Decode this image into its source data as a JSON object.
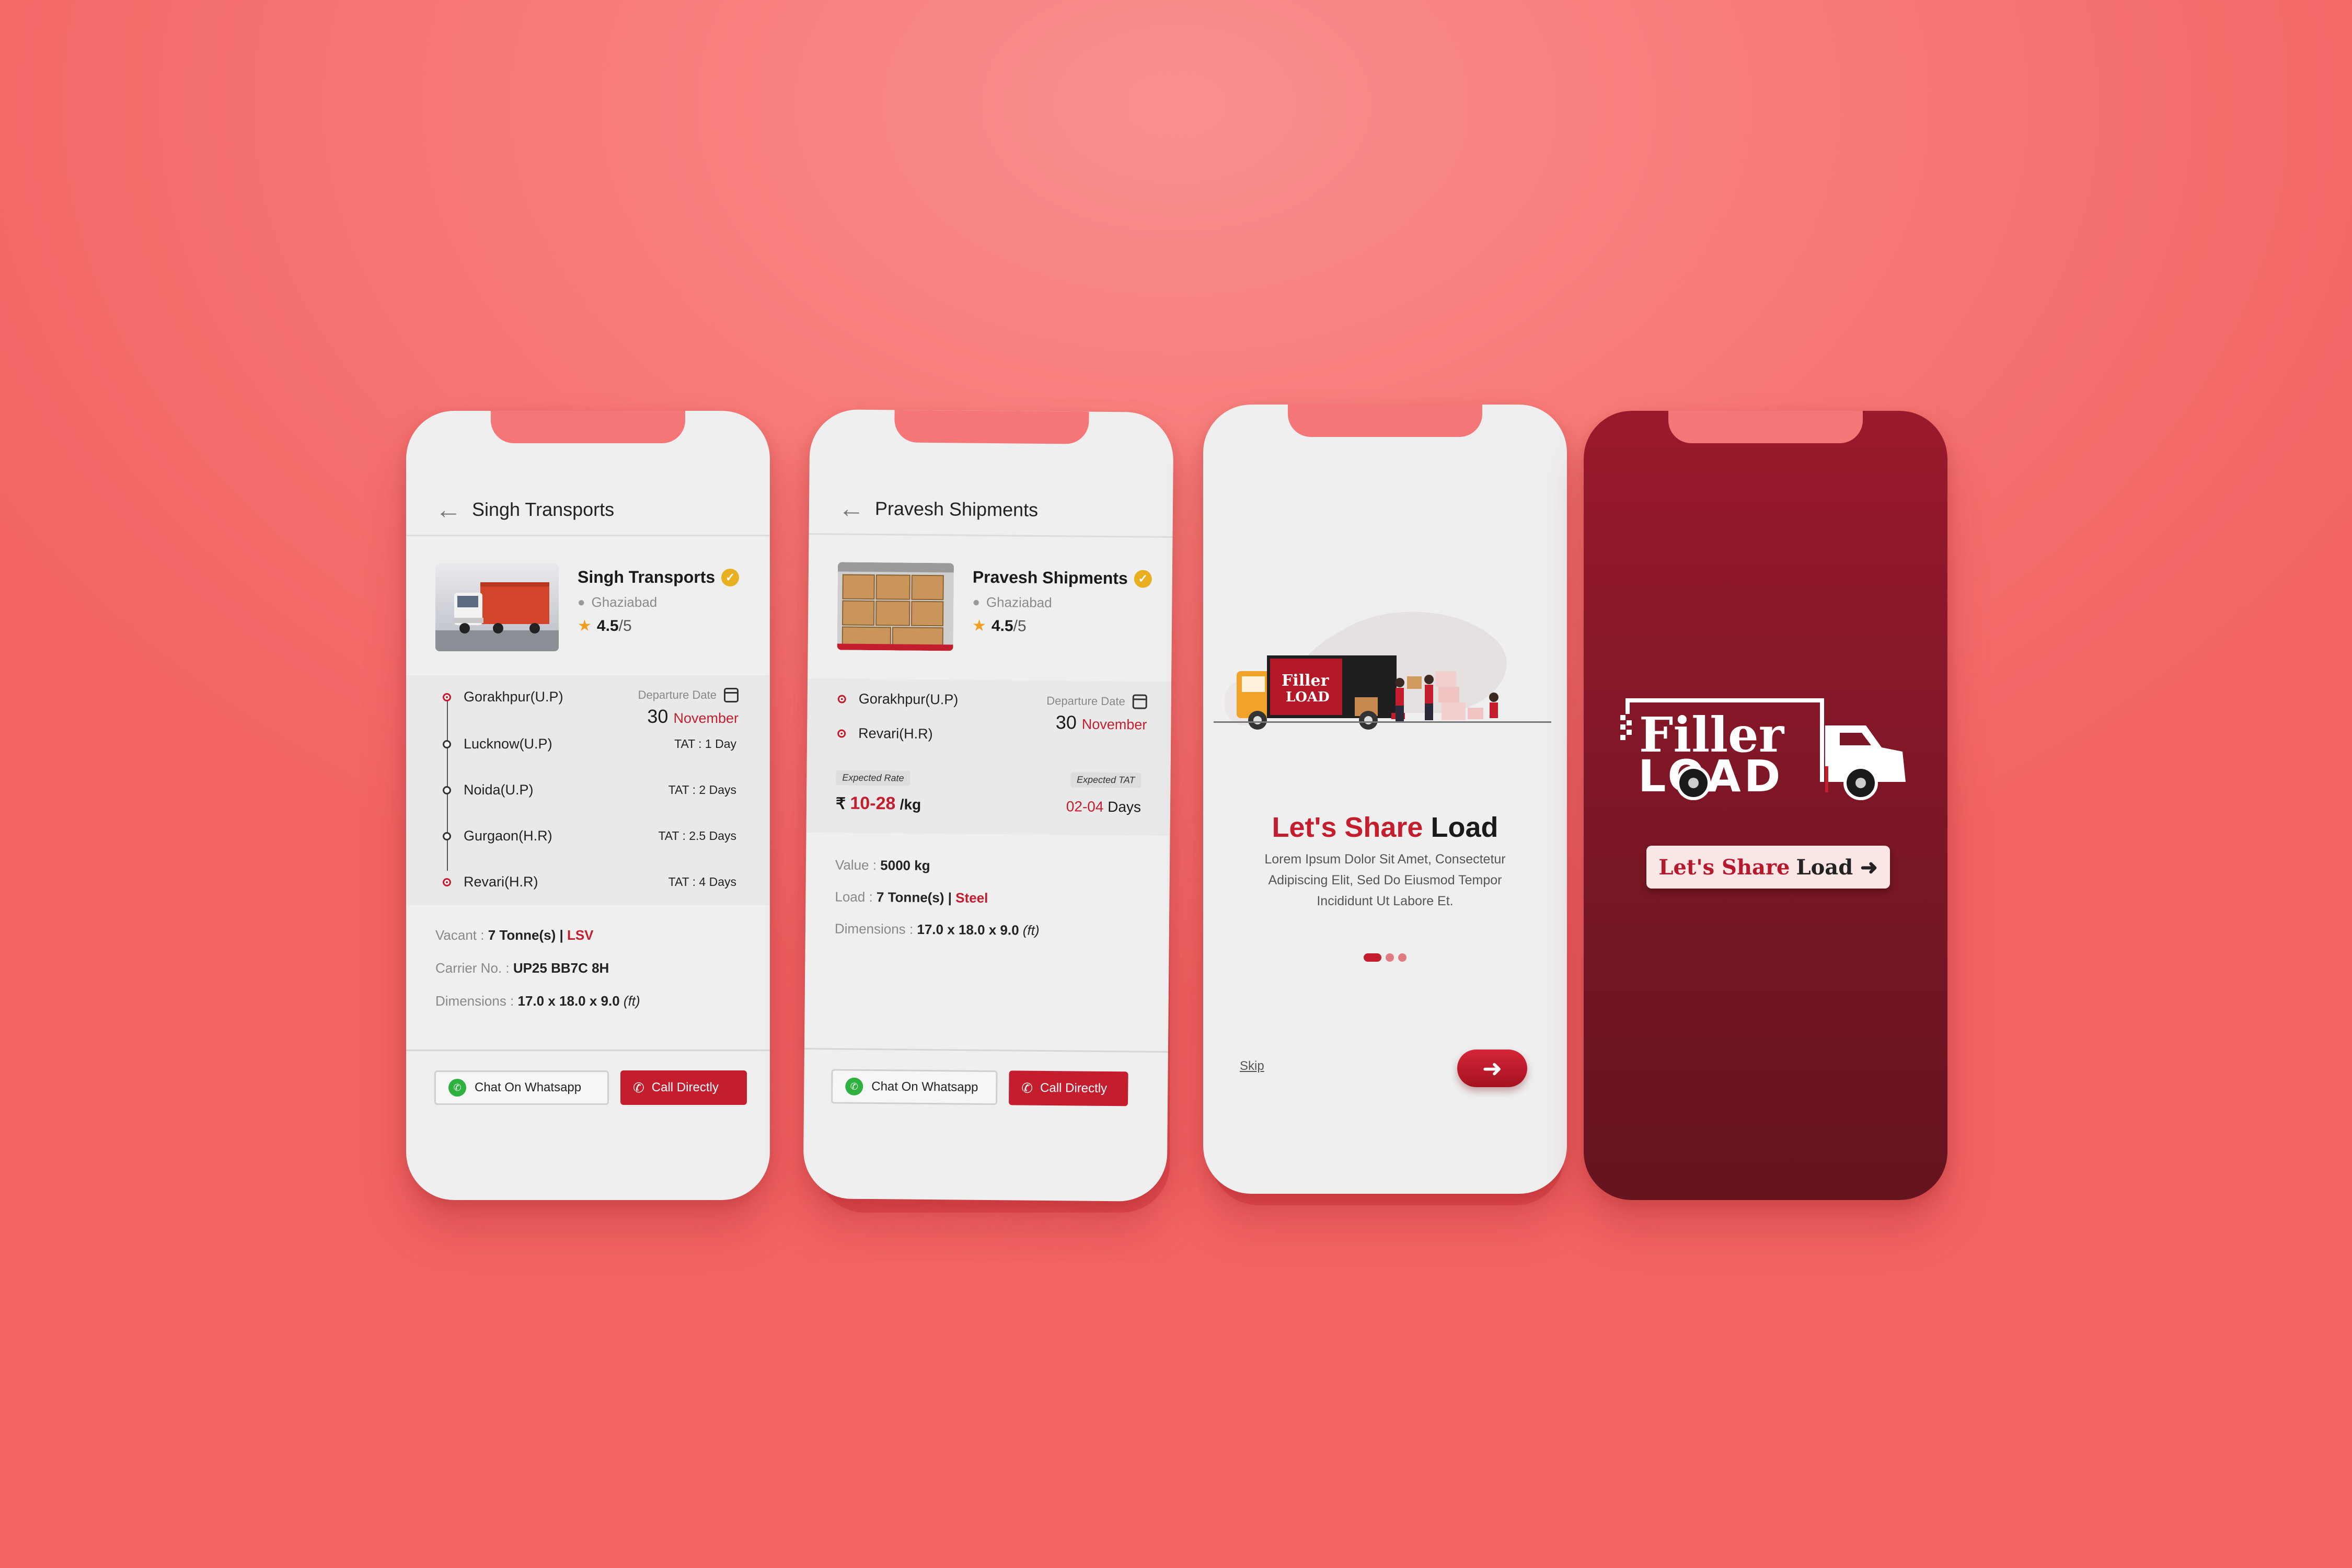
{
  "transport": {
    "header_title": "Singh Transports",
    "name": "Singh Transports",
    "location": "Ghaziabad",
    "rating": "4.5",
    "rating_of": "/5",
    "departure_label": "Departure Date",
    "departure_day": "30",
    "departure_month": "November",
    "stops": [
      {
        "name": "Gorakhpur(U.P)",
        "tat": ""
      },
      {
        "name": "Lucknow(U.P)",
        "tat": "TAT : 1 Day"
      },
      {
        "name": "Noida(U.P)",
        "tat": "TAT : 2 Days"
      },
      {
        "name": "Gurgaon(H.R)",
        "tat": "TAT : 2.5 Days"
      },
      {
        "name": "Revari(H.R)",
        "tat": "TAT : 4 Days"
      }
    ],
    "vacant_label": "Vacant  :",
    "vacant_value": "7 Tonne(s) |",
    "vacant_type": "LSV",
    "carrier_label": "Carrier No. :",
    "carrier_value": "UP25 BB7C 8H",
    "dimensions_label": "Dimensions :",
    "dimensions_value": "17.0 x 18.0 x 9.0",
    "dimensions_unit": "(ft)",
    "whatsapp_label": "Chat On Whatsapp",
    "call_label": "Call Directly"
  },
  "shipment": {
    "header_title": "Pravesh Shipments",
    "name": "Pravesh Shipments",
    "location": "Ghaziabad",
    "rating": "4.5",
    "rating_of": "/5",
    "origin": "Gorakhpur(U.P)",
    "destination": "Revari(H.R)",
    "departure_label": "Departure Date",
    "departure_day": "30",
    "departure_month": "November",
    "rate_tag": "Expected Rate",
    "rate_symbol": "₹",
    "rate_value": "10-28",
    "rate_unit": "/kg",
    "tat_tag": "Expected TAT",
    "tat_value": "02-04",
    "tat_unit": "Days",
    "value_label": "Value :",
    "value_value": "5000 kg",
    "load_label": "Load :",
    "load_value": "7 Tonne(s) |",
    "load_type": "Steel",
    "dimensions_label": "Dimensions :",
    "dimensions_value": "17.0 x 18.0 x 9.0",
    "dimensions_unit": "(ft)",
    "whatsapp_label": "Chat On Whatsapp",
    "call_label": "Call Directly"
  },
  "onboarding": {
    "logo_top": "Filler",
    "logo_bottom": "LOAD",
    "title_red": "Let's Share",
    "title_dark": "Load",
    "body": "Lorem Ipsum Dolor Sit Amet, Consectetur Adipiscing Elit, Sed Do Eiusmod Tempor Incididunt Ut Labore Et.",
    "skip_label": "Skip",
    "page_count": 3,
    "active_page": 1
  },
  "splash": {
    "logo_top": "Filler",
    "logo_bottom": "LOAD",
    "cta_red": "Let's Share",
    "cta_dark": "Load"
  },
  "colors": {
    "brand_red": "#c41e2e",
    "splash_top": "#9a1a2b",
    "background": "#f77b78"
  }
}
